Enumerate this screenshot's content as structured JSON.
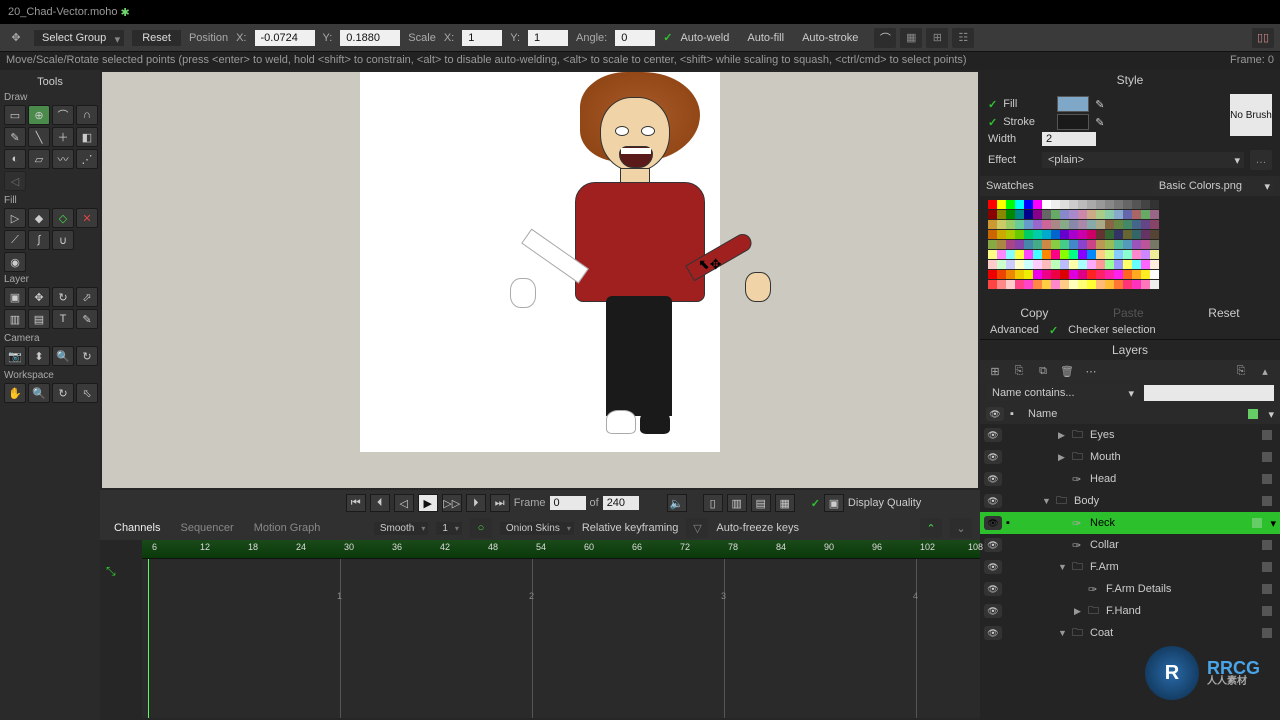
{
  "titlebar": {
    "filename": "20_Chad-Vector.moho",
    "dirty": "✱"
  },
  "topbar": {
    "select_group": "Select Group",
    "reset": "Reset",
    "position": "Position",
    "x": "X:",
    "xval": "-0.0724",
    "y": "Y:",
    "yval": "0.1880",
    "scale": "Scale",
    "sxval": "1",
    "syval": "1",
    "angle": "Angle:",
    "angval": "0",
    "autoweld": "Auto-weld",
    "autofill": "Auto-fill",
    "autostroke": "Auto-stroke"
  },
  "hint": {
    "text": "Move/Scale/Rotate selected points (press <enter> to weld, hold <shift> to constrain, <alt> to disable auto-welding, <alt> to scale to center, <shift> while scaling to squash, <ctrl/cmd> to select points)",
    "frame": "Frame: 0"
  },
  "tools": {
    "title": "Tools",
    "draw": "Draw",
    "fill": "Fill",
    "layer": "Layer",
    "camera": "Camera",
    "workspace": "Workspace"
  },
  "playbar": {
    "frame": "Frame",
    "frameval": "0",
    "of": "of",
    "total": "240",
    "display_quality": "Display Quality"
  },
  "tlopts": {
    "channels": "Channels",
    "sequencer": "Sequencer",
    "motion_graph": "Motion Graph",
    "smooth": "Smooth",
    "one": "1",
    "onion": "Onion Skins",
    "relkey": "Relative keyframing",
    "autofreeze": "Auto-freeze keys"
  },
  "ruler": [
    "6",
    "12",
    "18",
    "24",
    "30",
    "36",
    "42",
    "48",
    "54",
    "60",
    "66",
    "72",
    "78",
    "84",
    "90",
    "96",
    "102",
    "108"
  ],
  "style": {
    "title": "Style",
    "fill": "Fill",
    "stroke": "Stroke",
    "width": "Width",
    "widthval": "2",
    "effect": "Effect",
    "effectval": "<plain>",
    "nobrush": "No Brush",
    "swatches": "Swatches",
    "swatchfile": "Basic Colors.png",
    "copy": "Copy",
    "paste": "Paste",
    "resetbtn": "Reset",
    "advanced": "Advanced",
    "checker": "Checker selection",
    "fill_swatch": "#7fa8c8",
    "stroke_swatch": "#1a1a1a"
  },
  "layers": {
    "title": "Layers",
    "name_header": "Name",
    "filter": "Name contains...",
    "items": [
      {
        "name": "Eyes",
        "icon": "group",
        "depth": 2,
        "expand": "▶"
      },
      {
        "name": "Mouth",
        "icon": "group",
        "depth": 2,
        "expand": "▶"
      },
      {
        "name": "Head",
        "icon": "vector",
        "depth": 2
      },
      {
        "name": "Body",
        "icon": "folder",
        "depth": 1,
        "expand": "▼"
      },
      {
        "name": "Neck",
        "icon": "vector",
        "depth": 2,
        "sel": true
      },
      {
        "name": "Collar",
        "icon": "vector",
        "depth": 2
      },
      {
        "name": "F.Arm",
        "icon": "group",
        "depth": 2,
        "expand": "▼"
      },
      {
        "name": "F.Arm Details",
        "icon": "vector",
        "depth": 3
      },
      {
        "name": "F.Hand",
        "icon": "group",
        "depth": 3,
        "expand": "▶"
      },
      {
        "name": "Coat",
        "icon": "folder",
        "depth": 2,
        "expand": "▼"
      }
    ]
  },
  "swatches_colors": [
    [
      "#f00",
      "#ff0",
      "#0f0",
      "#0ff",
      "#00f",
      "#f0f",
      "#fff",
      "#eee",
      "#ddd",
      "#ccc",
      "#bbb",
      "#aaa",
      "#999",
      "#888",
      "#777",
      "#666",
      "#555",
      "#444",
      "#333"
    ],
    [
      "#800",
      "#880",
      "#080",
      "#088",
      "#008",
      "#808",
      "#666",
      "#6a6",
      "#88c",
      "#a8c",
      "#c8a",
      "#ca8",
      "#ac8",
      "#8ca",
      "#8ac",
      "#66a",
      "#a66",
      "#6a6",
      "#968"
    ],
    [
      "#c93",
      "#cc6",
      "#9c6",
      "#6c9",
      "#69c",
      "#96c",
      "#c69",
      "#a88",
      "#8a8",
      "#88a",
      "#a8a",
      "#8aa",
      "#aa8",
      "#864",
      "#684",
      "#486",
      "#468",
      "#648",
      "#846"
    ],
    [
      "#c60",
      "#ca0",
      "#ac0",
      "#6c0",
      "#0c6",
      "#0ca",
      "#0ac",
      "#06c",
      "#60c",
      "#a0c",
      "#c0a",
      "#c06",
      "#633",
      "#363",
      "#336",
      "#663",
      "#366",
      "#636",
      "#543"
    ],
    [
      "#8a4",
      "#a84",
      "#a48",
      "#84a",
      "#48a",
      "#4a8",
      "#c84",
      "#8c4",
      "#4c8",
      "#48c",
      "#84c",
      "#c48",
      "#b95",
      "#9b5",
      "#5b9",
      "#59b",
      "#95b",
      "#b59",
      "#776"
    ],
    [
      "#ff8",
      "#f8f",
      "#8ff",
      "#ff4",
      "#f4f",
      "#4ff",
      "#f80",
      "#f08",
      "#8f0",
      "#0f8",
      "#80f",
      "#08f",
      "#fc8",
      "#cf8",
      "#8cf",
      "#8fc",
      "#f8c",
      "#c8f",
      "#ee9"
    ],
    [
      "#fcc",
      "#cfc",
      "#ccf",
      "#ffc",
      "#cff",
      "#fcf",
      "#fbb",
      "#bfb",
      "#bbf",
      "#ffa",
      "#aff",
      "#faf",
      "#f99",
      "#9f9",
      "#99f",
      "#ff6",
      "#6ff",
      "#f6f",
      "#fed"
    ],
    [
      "#e00",
      "#e40",
      "#e80",
      "#ec0",
      "#ee0",
      "#e0e",
      "#e08",
      "#e04",
      "#d00",
      "#d0d",
      "#d08",
      "#f22",
      "#f26",
      "#f2a",
      "#f2e",
      "#f62",
      "#fa2",
      "#fe2",
      "#fff"
    ],
    [
      "#f44",
      "#f88",
      "#fcc",
      "#f48",
      "#f4c",
      "#f84",
      "#fc4",
      "#f8c",
      "#fc8",
      "#ffb",
      "#ff7",
      "#ff3",
      "#fb7",
      "#fb3",
      "#f73",
      "#f37",
      "#f3b",
      "#f7b",
      "#eee"
    ]
  ]
}
